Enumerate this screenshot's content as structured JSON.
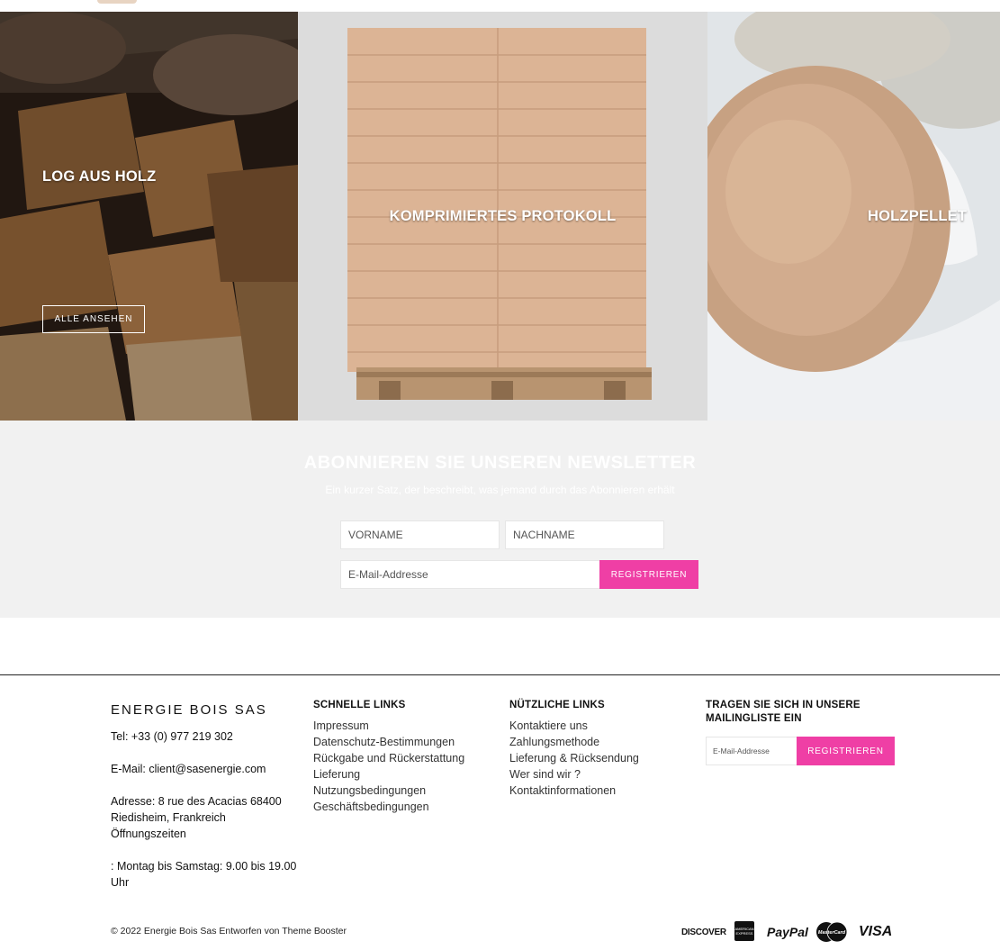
{
  "categories": [
    {
      "title": "LOG AUS HOLZ",
      "button_label": "ALLE ANSEHEN"
    },
    {
      "title": "KOMPRIMIERTES PROTOKOLL"
    },
    {
      "title": "HOLZPELLET"
    }
  ],
  "newsletter": {
    "title": "ABONNIEREN SIE UNSEREN NEWSLETTER",
    "subtitle": "Ein kurzer Satz, der beschreibt, was jemand durch das Abonnieren erhält",
    "first_name_placeholder": "VORNAME",
    "last_name_placeholder": "NACHNAME",
    "email_placeholder": "E-Mail-Addresse",
    "submit_label": "REGISTRIEREN"
  },
  "footer": {
    "brand": {
      "name": "ENERGIE BOIS SAS",
      "phone": "Tel: +33 (0) 977 219 302",
      "email": "E-Mail: client@sasenergie.com",
      "address": "Adresse: 8 rue des Acacias 68400 Riedisheim, Frankreich Öffnungszeiten",
      "hours": ": Montag bis Samstag: 9.00 bis 19.00 Uhr"
    },
    "quick_links": {
      "heading": "SCHNELLE LINKS",
      "items": [
        "Impressum",
        "Datenschutz-Bestimmungen",
        "Rückgabe und Rückerstattung",
        "Lieferung",
        "Nutzungsbedingungen",
        "Geschäftsbedingungen"
      ]
    },
    "useful_links": {
      "heading": "NÜTZLICHE LINKS",
      "items": [
        "Kontaktiere uns",
        "Zahlungsmethode",
        "Lieferung & Rücksendung",
        "Wer sind wir ?",
        "Kontaktinformationen"
      ]
    },
    "mailing": {
      "heading": "TRAGEN SIE SICH IN UNSERE MAILINGLISTE EIN",
      "email_placeholder": "E-Mail-Addresse",
      "submit_label": "REGISTRIEREN"
    },
    "copyright": "© 2022 Energie Bois Sas Entworfen von Theme Booster",
    "payment_methods": [
      {
        "icon": "discover-icon",
        "label": "DISCOVER"
      },
      {
        "icon": "amex-icon",
        "label": "AMERICAN EXPRESS"
      },
      {
        "icon": "paypal-icon",
        "label": "PayPal"
      },
      {
        "icon": "mastercard-icon",
        "label": "MasterCard"
      },
      {
        "icon": "visa-icon",
        "label": "VISA"
      }
    ]
  },
  "colors": {
    "accent": "#ef3fa5",
    "newsletter_bg": "#f1f1f1"
  }
}
